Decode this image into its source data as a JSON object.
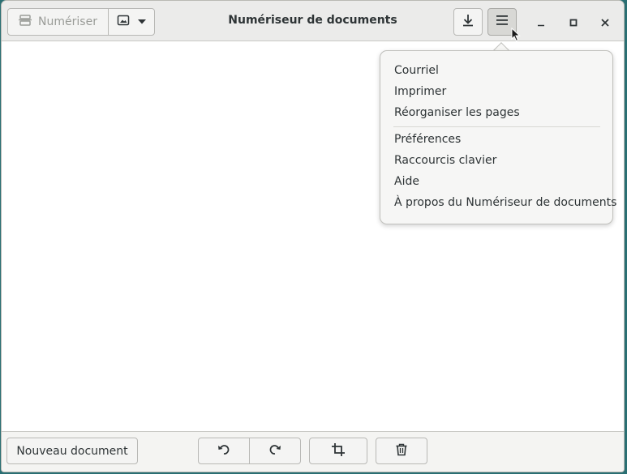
{
  "header": {
    "title": "Numériseur de documents",
    "scan_label": "Numériser"
  },
  "menu": {
    "items": [
      {
        "label": "Courriel"
      },
      {
        "label": "Imprimer"
      },
      {
        "label": "Réorganiser les pages"
      },
      {
        "label": "Préférences"
      },
      {
        "label": "Raccourcis clavier"
      },
      {
        "label": "Aide"
      },
      {
        "label": "À propos du Numériseur de documents"
      }
    ]
  },
  "bottombar": {
    "new_document_label": "Nouveau document"
  },
  "icons": {
    "scan": "scanner-icon",
    "image_mode": "image-icon",
    "dropdown": "chevron-down-icon",
    "save": "download-icon",
    "menu": "hamburger-menu-icon",
    "minimize": "minimize-icon",
    "maximize": "maximize-icon",
    "close": "close-icon",
    "rotate_left": "rotate-left-icon",
    "rotate_right": "rotate-right-icon",
    "crop": "crop-icon",
    "delete": "trash-icon"
  }
}
